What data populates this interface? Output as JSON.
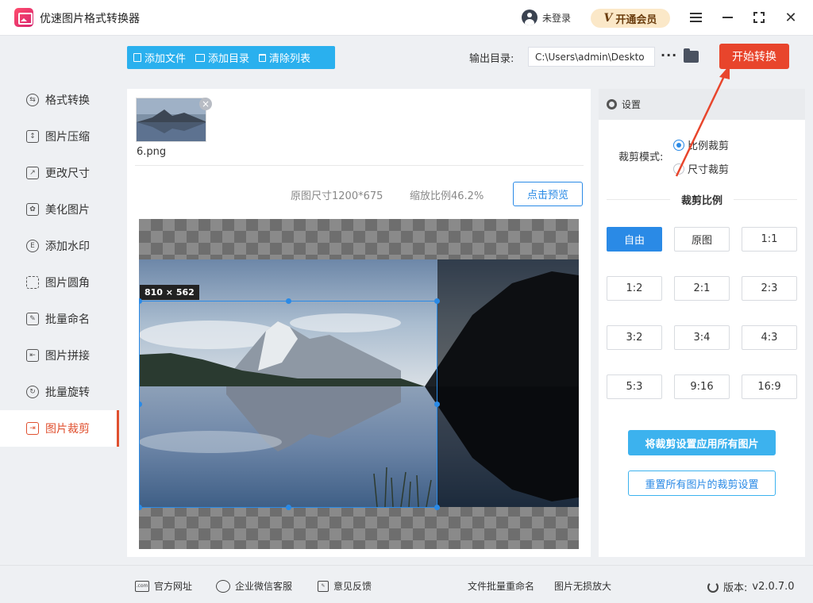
{
  "app": {
    "title": "优速图片格式转换器"
  },
  "header": {
    "user_label": "未登录",
    "vip_label": "开通会员",
    "vip_icon_text": "V"
  },
  "sidebar": {
    "items": [
      {
        "label": "格式转换",
        "icon": "format-convert-icon"
      },
      {
        "label": "图片压缩",
        "icon": "compress-icon"
      },
      {
        "label": "更改尺寸",
        "icon": "resize-icon"
      },
      {
        "label": "美化图片",
        "icon": "beautify-icon"
      },
      {
        "label": "添加水印",
        "icon": "watermark-icon"
      },
      {
        "label": "图片圆角",
        "icon": "round-corner-icon"
      },
      {
        "label": "批量命名",
        "icon": "rename-icon"
      },
      {
        "label": "图片拼接",
        "icon": "stitch-icon"
      },
      {
        "label": "批量旋转",
        "icon": "rotate-icon"
      },
      {
        "label": "图片裁剪",
        "icon": "crop-icon",
        "active": true
      }
    ]
  },
  "toolbar": {
    "add_file": "添加文件",
    "add_folder": "添加目录",
    "clear_list": "清除列表",
    "output_label": "输出目录:",
    "output_path": "C:\\Users\\admin\\Deskto",
    "more": "···",
    "start": "开始转换"
  },
  "file": {
    "name": "6.png"
  },
  "preview": {
    "original_size": "原图尺寸1200*675",
    "zoom_ratio": "缩放比例46.2%",
    "preview_button": "点击预览",
    "crop_size": "810 × 562"
  },
  "settings": {
    "title": "设置",
    "crop_mode_label": "裁剪模式:",
    "mode_ratio": "比例裁剪",
    "mode_size": "尺寸裁剪",
    "selected_mode": "比例裁剪",
    "ratio_title": "裁剪比例",
    "ratios": [
      "自由",
      "原图",
      "1:1",
      "1:2",
      "2:1",
      "2:3",
      "3:2",
      "3:4",
      "4:3",
      "5:3",
      "9:16",
      "16:9"
    ],
    "selected_ratio": "自由",
    "apply_all": "将裁剪设置应用所有图片",
    "reset_all": "重置所有图片的裁剪设置"
  },
  "footer": {
    "website": "官方网址",
    "wechat": "企业微信客服",
    "feedback": "意见反馈",
    "batch_rename": "文件批量重命名",
    "lossless_zoom": "图片无损放大",
    "version_label": "版本:",
    "version": "v2.0.7.0"
  },
  "colors": {
    "accent_blue": "#2a8ae6",
    "toolbar_blue": "#2ab0ee",
    "start_red": "#e8452c",
    "active_red": "#e0502f",
    "vip_gold": "#fbe8c8"
  }
}
